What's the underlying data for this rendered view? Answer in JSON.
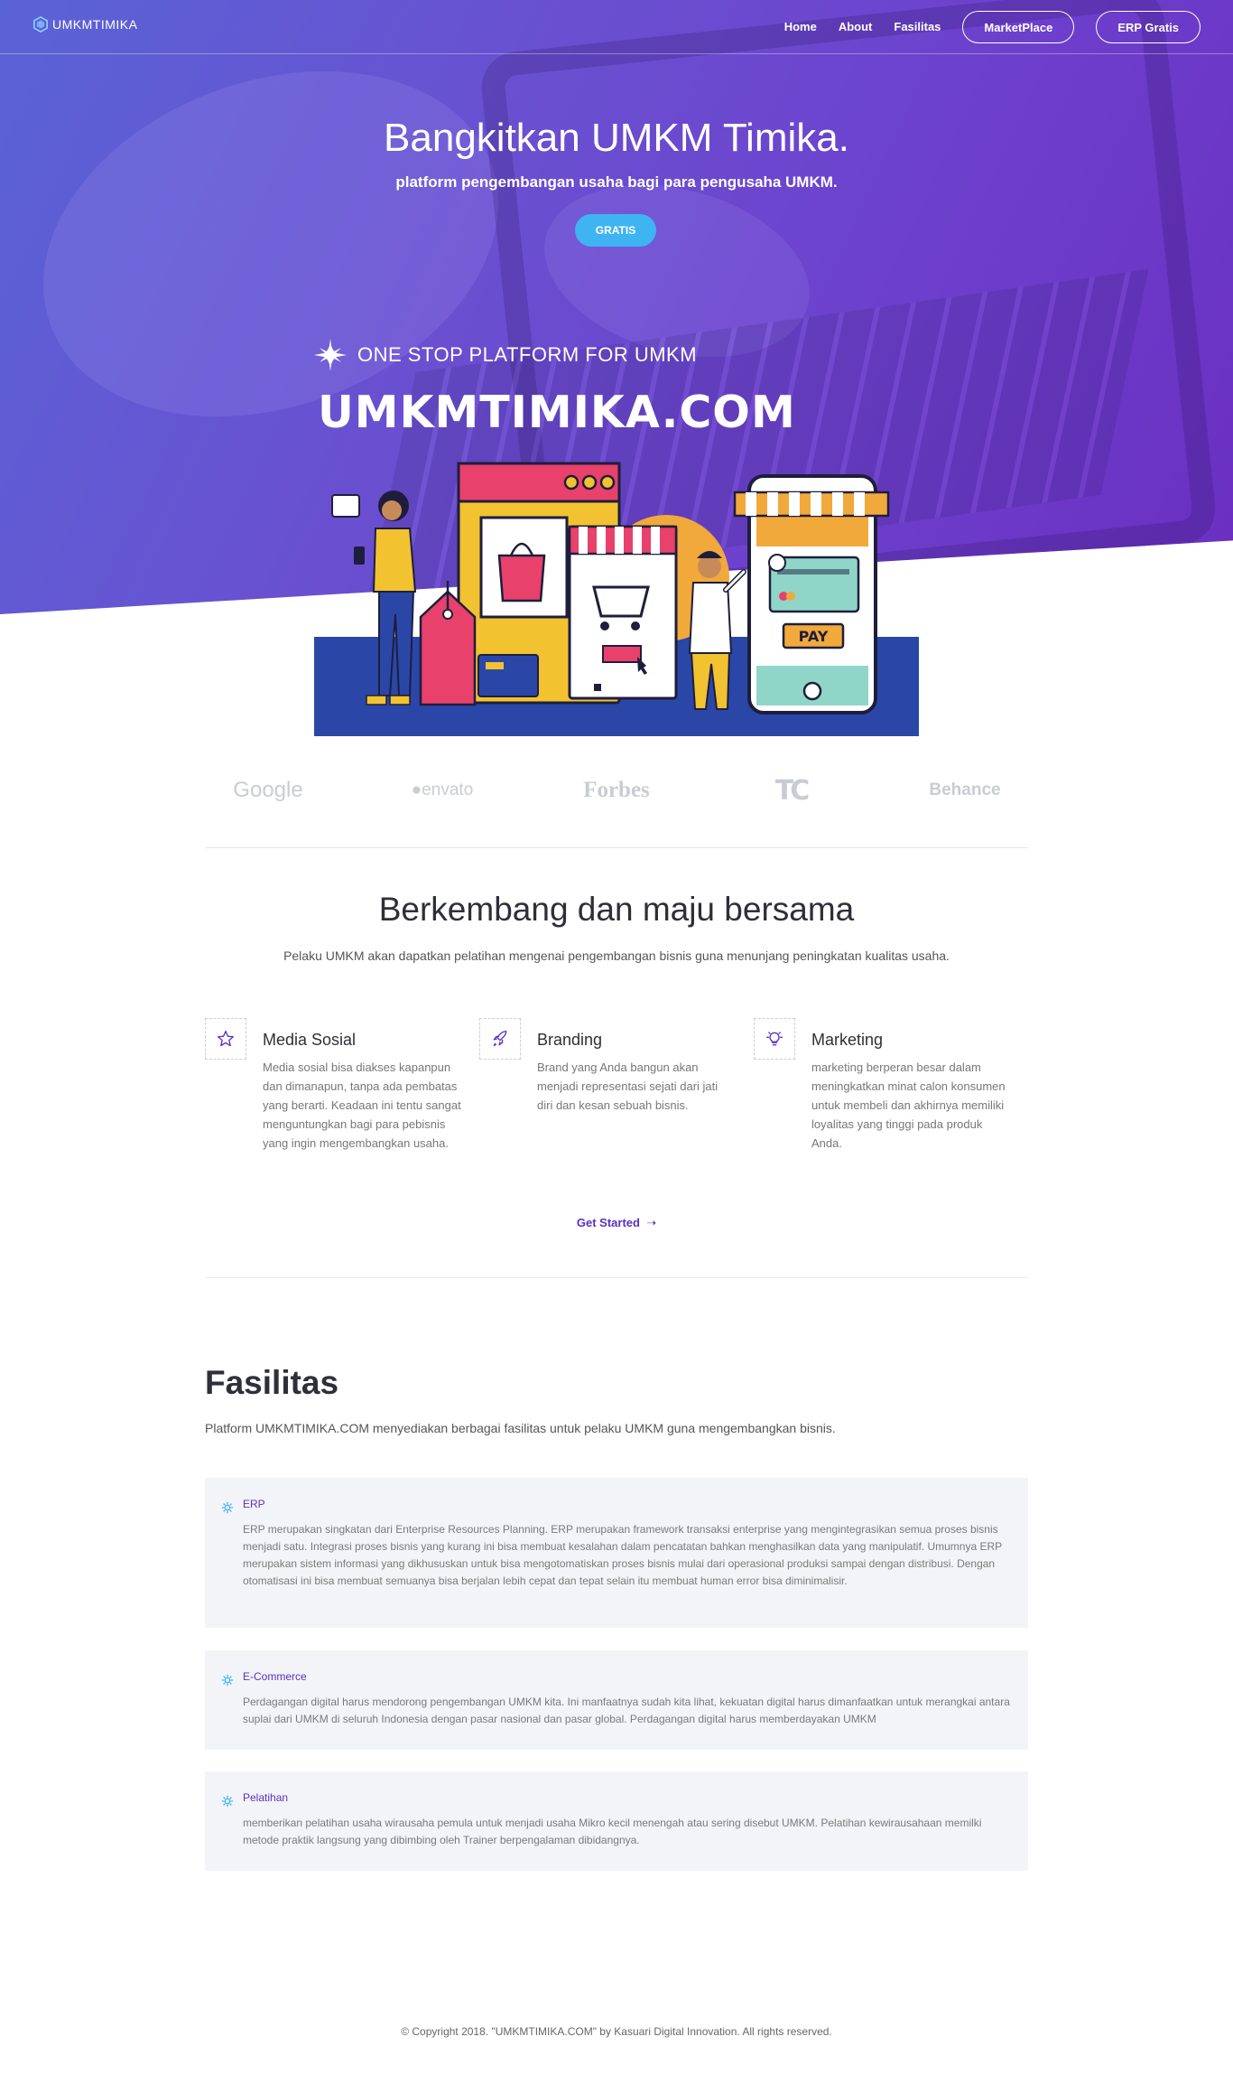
{
  "brand": {
    "name": "UMKMTIMIKA"
  },
  "nav": {
    "links": [
      "Home",
      "About",
      "Fasilitas"
    ],
    "marketplace": "MarketPlace",
    "erp": "ERP Gratis"
  },
  "hero": {
    "title": "Bangkitkan UMKM Timika.",
    "subtitle": "platform pengembangan usaha bagi para pengusaha UMKM.",
    "cta": "GRATIS",
    "tagline": "ONE STOP PLATFORM FOR UMKM",
    "big_title": "UMKMTIMIKA.COM",
    "pay_label": "PAY"
  },
  "partners": [
    "Google",
    "envato",
    "Forbes",
    "TC",
    "Behance"
  ],
  "features_section": {
    "title": "Berkembang dan maju bersama",
    "description": "Pelaku UMKM akan dapatkan pelatihan mengenai pengembangan bisnis guna menunjang peningkatan kualitas usaha.",
    "items": [
      {
        "title": "Media Sosial",
        "icon": "star-icon",
        "text": "Media sosial bisa diakses kapanpun dan dimanapun, tanpa ada pembatas yang berarti. Keadaan ini tentu sangat menguntungkan bagi para pebisnis yang ingin mengembangkan usaha."
      },
      {
        "title": "Branding",
        "icon": "rocket-icon",
        "text": "Brand yang Anda bangun akan menjadi representasi sejati dari jati diri dan kesan sebuah bisnis."
      },
      {
        "title": "Marketing",
        "icon": "lightbulb-icon",
        "text": "marketing berperan besar dalam meningkatkan minat calon konsumen untuk membeli dan akhirnya memiliki loyalitas yang tinggi pada produk Anda."
      }
    ],
    "get_started": "Get Started"
  },
  "fasilitas": {
    "title": "Fasilitas",
    "description": "Platform UMKMTIMIKA.COM menyediakan berbagai fasilitas untuk pelaku UMKM guna mengembangkan bisnis.",
    "cards": [
      {
        "title": "ERP",
        "text": "ERP merupakan singkatan dari Enterprise Resources Planning. ERP merupakan framework transaksi enterprise yang mengintegrasikan semua proses bisnis menjadi satu. Integrasi proses bisnis yang kurang ini bisa membuat kesalahan dalam pencatatan bahkan menghasilkan data yang manipulatif. Umumnya ERP merupakan sistem informasi yang dikhususkan untuk bisa mengotomatiskan proses bisnis mulai dari operasional produksi sampai dengan distribusi. Dengan otomatisasi ini bisa membuat semuanya bisa berjalan lebih cepat dan tepat selain itu membuat human error bisa diminimalisir."
      },
      {
        "title": "E-Commerce",
        "text": "Perdagangan digital harus mendorong pengembangan UMKM kita. Ini manfaatnya sudah kita lihat, kekuatan digital harus dimanfaatkan untuk merangkai antara suplai dari UMKM di seluruh Indonesia dengan pasar nasional dan pasar global. Perdagangan digital harus memberdayakan UMKM"
      },
      {
        "title": "Pelatihan",
        "text": "memberikan pelatihan usaha wirausaha pemula untuk menjadi usaha Mikro kecil menengah atau sering disebut UMKM. Pelatihan kewirausahaan memilki metode praktik langsung yang dibimbing oleh Trainer berpengalaman dibidangnya."
      }
    ]
  },
  "footer": {
    "copyright": "© Copyright 2018. \"UMKMTIMIKA.COM\" by Kasuari Digital Innovation. All rights reserved."
  },
  "colors": {
    "accent": "#5b2fc4",
    "cta": "#3fb4f3",
    "hero_start": "#5a63d6",
    "hero_end": "#6a2fc0"
  }
}
